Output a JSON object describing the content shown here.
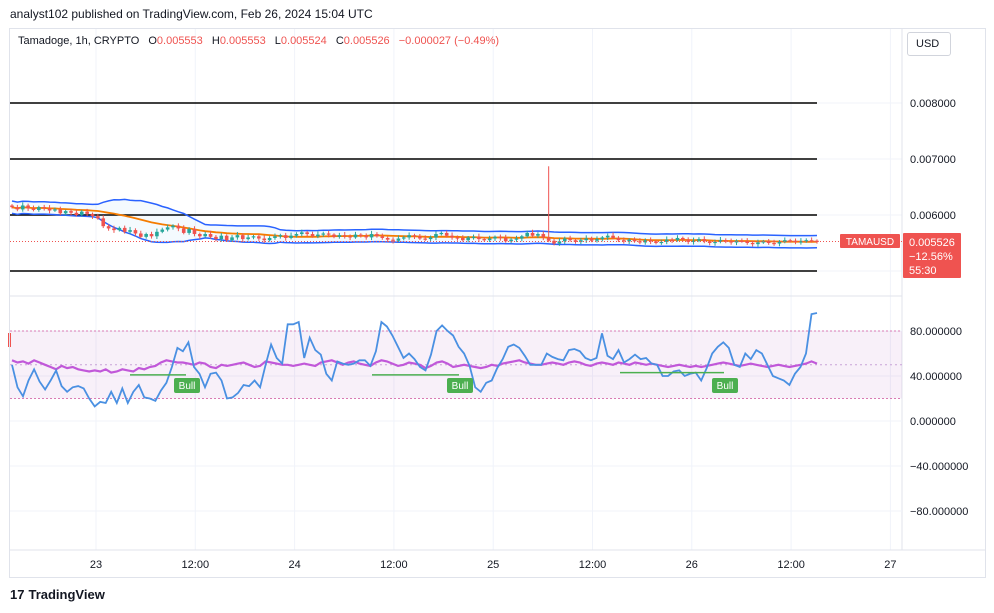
{
  "header": {
    "publisher": "analyst102 published on TradingView.com, Feb 26, 2024 15:04 UTC"
  },
  "legend": {
    "symbol": "Tamadoge, 1h, CRYPTO",
    "o_label": "O",
    "o": "0.005553",
    "h_label": "H",
    "h": "0.005553",
    "l_label": "L",
    "l": "0.005524",
    "c_label": "C",
    "c": "0.005526",
    "change": "−0.000027 (−0.49%)"
  },
  "currency_button": "USD",
  "price_badge": {
    "ticker": "TAMAUSD",
    "price": "0.005526",
    "pct": "−12.56%",
    "countdown": "55:30"
  },
  "footer": {
    "logo": "TradingView",
    "logo_mark": "17"
  },
  "colors": {
    "up": "#26a69a",
    "down": "#ef5350",
    "bollinger": "#2962ff",
    "ma": "#f57c00",
    "stoch_k": "#4a90e2",
    "stoch_d": "#c158d9",
    "bull": "#4caf50",
    "hline": "#000000"
  },
  "chart_data": [
    {
      "type": "candlestick",
      "title": "Tamadoge, 1h, CRYPTO",
      "y_ticks": [
        "0.008000",
        "0.007000",
        "0.006000"
      ],
      "ylim": [
        0.0051,
        0.0087
      ],
      "x_ticks": [
        "23",
        "12:00",
        "24",
        "12:00",
        "25",
        "12:00",
        "26",
        "12:00",
        "27"
      ],
      "horizontal_levels": [
        0.008,
        0.007,
        0.006,
        0.005
      ],
      "close": [
        0.00614,
        0.0061,
        0.00617,
        0.00612,
        0.00609,
        0.00614,
        0.00612,
        0.00608,
        0.0061,
        0.00603,
        0.00607,
        0.00604,
        0.006,
        0.00606,
        0.00602,
        0.00598,
        0.00594,
        0.0058,
        0.00576,
        0.00573,
        0.00577,
        0.0057,
        0.00573,
        0.00567,
        0.00561,
        0.00566,
        0.00562,
        0.0057,
        0.00574,
        0.00578,
        0.00581,
        0.00576,
        0.00568,
        0.00575,
        0.00566,
        0.00562,
        0.00566,
        0.00561,
        0.00557,
        0.00563,
        0.00555,
        0.0056,
        0.00564,
        0.00557,
        0.0056,
        0.00562,
        0.00558,
        0.00555,
        0.00559,
        0.00562,
        0.00564,
        0.00559,
        0.00563,
        0.00566,
        0.00569,
        0.00566,
        0.00562,
        0.00565,
        0.00567,
        0.00565,
        0.00561,
        0.00564,
        0.00562,
        0.0056,
        0.00565,
        0.00563,
        0.0056,
        0.00566,
        0.00562,
        0.00559,
        0.00556,
        0.00554,
        0.00558,
        0.0056,
        0.00564,
        0.00562,
        0.00558,
        0.00557,
        0.0056,
        0.00566,
        0.00568,
        0.00563,
        0.0056,
        0.00559,
        0.00555,
        0.0056,
        0.00561,
        0.00557,
        0.00555,
        0.00558,
        0.00561,
        0.00559,
        0.00553,
        0.00556,
        0.00558,
        0.00562,
        0.00568,
        0.00563,
        0.00566,
        0.0056,
        0.00554,
        0.00549,
        0.00553,
        0.00558,
        0.00555,
        0.00552,
        0.00555,
        0.00558,
        0.00554,
        0.00557,
        0.0056,
        0.00563,
        0.00559,
        0.00555,
        0.00553,
        0.00556,
        0.00553,
        0.00551,
        0.00555,
        0.00553,
        0.0055,
        0.00552,
        0.00556,
        0.00555,
        0.00559,
        0.00556,
        0.00552,
        0.00554,
        0.00557,
        0.00553,
        0.0055,
        0.00552,
        0.00555,
        0.00553,
        0.00551,
        0.00554,
        0.00553,
        0.0055,
        0.00548,
        0.00551,
        0.00553,
        0.0055,
        0.00549,
        0.00552,
        0.00555,
        0.00554,
        0.00552,
        0.00553,
        0.00555,
        0.00554,
        0.00553
      ],
      "wick_spike": {
        "index": 100,
        "high": 0.00687
      },
      "last_price": 0.005526
    },
    {
      "type": "line",
      "title": "Stochastic oscillator",
      "y_ticks": [
        "80.000000",
        "40.000000",
        "0.000000",
        "−40.000000",
        "−80.000000"
      ],
      "ylim": [
        -112,
        108
      ],
      "band": [
        20,
        80
      ],
      "k": [
        50,
        30,
        22,
        36,
        46,
        35,
        28,
        36,
        45,
        31,
        26,
        30,
        31,
        29,
        20,
        13,
        17,
        16,
        26,
        16,
        29,
        16,
        26,
        32,
        21,
        20,
        18,
        27,
        34,
        48,
        65,
        62,
        70,
        48,
        42,
        30,
        42,
        43,
        36,
        20,
        21,
        25,
        32,
        31,
        36,
        30,
        50,
        68,
        56,
        51,
        86,
        86,
        88,
        56,
        74,
        63,
        59,
        42,
        36,
        53,
        51,
        50,
        51,
        54,
        54,
        49,
        62,
        88,
        84,
        76,
        66,
        56,
        60,
        55,
        48,
        45,
        59,
        80,
        85,
        80,
        76,
        66,
        60,
        49,
        30,
        26,
        34,
        36,
        47,
        55,
        66,
        68,
        65,
        58,
        50,
        50,
        50,
        60,
        57,
        55,
        54,
        63,
        64,
        62,
        56,
        54,
        56,
        78,
        58,
        55,
        63,
        52,
        55,
        59,
        55,
        56,
        51,
        50,
        40,
        40,
        44,
        45,
        40,
        42,
        43,
        36,
        47,
        60,
        66,
        70,
        65,
        50,
        48,
        60,
        55,
        63,
        60,
        50,
        40,
        38,
        36,
        32,
        42,
        48,
        60,
        95,
        96
      ],
      "d": [
        54,
        52,
        53,
        51,
        54,
        52,
        50,
        48,
        46,
        49,
        47,
        48,
        46,
        45,
        44,
        45,
        44,
        46,
        43,
        44,
        46,
        45,
        44,
        47,
        46,
        48,
        49,
        52,
        54,
        53,
        52,
        52,
        51,
        50,
        52,
        51,
        48,
        47,
        50,
        49,
        50,
        51,
        52,
        50,
        48,
        49,
        53,
        52,
        51,
        50,
        50,
        49,
        50,
        51,
        50,
        49,
        52,
        53,
        54,
        52,
        50,
        52,
        53,
        51,
        50,
        49,
        52,
        54,
        53,
        51,
        49,
        50,
        52,
        51,
        50,
        47,
        49,
        52,
        53,
        51,
        48,
        49,
        50,
        49,
        48,
        47,
        48,
        50,
        49,
        51,
        52,
        53,
        54,
        52,
        51,
        50,
        50,
        51,
        52,
        51,
        50,
        52,
        53,
        52,
        50,
        49,
        51,
        52,
        51,
        50,
        52,
        51,
        50,
        52,
        51,
        50,
        51,
        50,
        49,
        48,
        49,
        50,
        49,
        48,
        49,
        48,
        49,
        50,
        51,
        52,
        51,
        50,
        49,
        50,
        51,
        50,
        49,
        48,
        49,
        50,
        49,
        48,
        49,
        50,
        51,
        53,
        51
      ],
      "bull_labels": [
        "Bull",
        "Bull",
        "Bull"
      ]
    }
  ]
}
